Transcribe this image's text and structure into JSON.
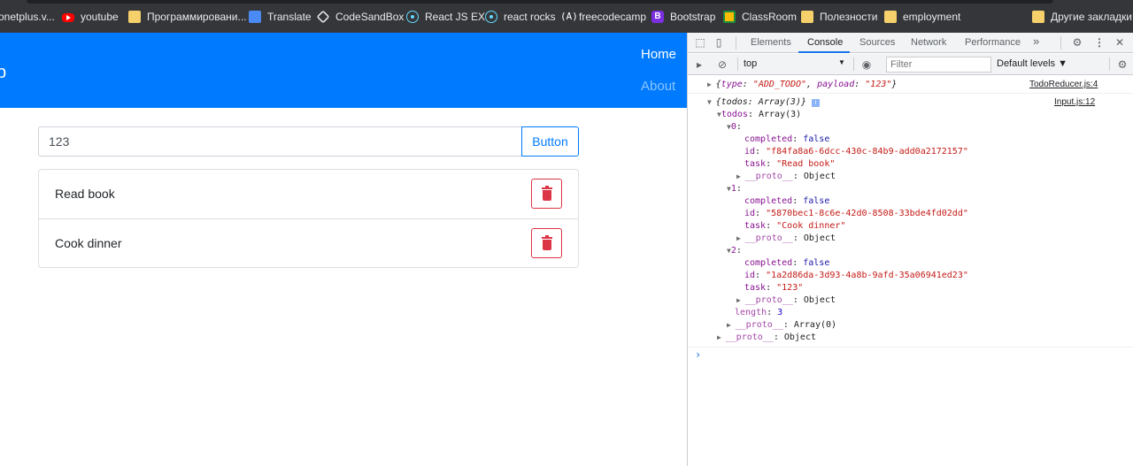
{
  "bookmarks": [
    {
      "label": "onetplus.v...",
      "icon": "none"
    },
    {
      "label": "youtube",
      "icon": "youtube-icon"
    },
    {
      "label": "Программировани...",
      "icon": "folder-icon"
    },
    {
      "label": "Translate",
      "icon": "translate-icon"
    },
    {
      "label": "CodeSandBox",
      "icon": "codesandbox-icon"
    },
    {
      "label": "React JS EX",
      "icon": "react-icon"
    },
    {
      "label": "react rocks",
      "icon": "react-icon"
    },
    {
      "label": "freecodecamp",
      "icon": "freecodecamp-icon"
    },
    {
      "label": "Bootstrap",
      "icon": "bootstrap-icon"
    },
    {
      "label": "ClassRoom",
      "icon": "classroom-icon"
    },
    {
      "label": "Полезности",
      "icon": "folder-icon"
    },
    {
      "label": "employment",
      "icon": "folder-icon"
    },
    {
      "label": "Другие закладки",
      "icon": "folder-icon"
    }
  ],
  "app": {
    "brand": "p",
    "nav": {
      "home": "Home",
      "about": "About"
    },
    "input_value": "123",
    "add_button": "Button",
    "todos": [
      {
        "task": "Read book"
      },
      {
        "task": "Cook dinner"
      }
    ],
    "colors": {
      "primary": "#007bff",
      "danger": "#dc3545"
    }
  },
  "devtools": {
    "tabs": [
      "Elements",
      "Console",
      "Sources",
      "Network",
      "Performance"
    ],
    "active_tab": "Console",
    "more_tabs": "»",
    "context": "top",
    "filter_placeholder": "Filter",
    "levels": "Default levels ▼",
    "messages": [
      {
        "summary_type_key": "type",
        "summary_type_val": "\"ADD_TODO\"",
        "summary_payload_key": "payload",
        "summary_payload_val": "\"123\"",
        "source": "TodoReducer.js:4"
      },
      {
        "summary": "{todos: Array(3)}",
        "source": "Input.js:12"
      }
    ],
    "tree": {
      "todos_label": "todos",
      "todos_val": "Array(3)",
      "items": [
        {
          "index": "0",
          "completed": "false",
          "id": "\"f84fa8a6-6dcc-430c-84b9-add0a2172157\"",
          "task": "\"Read book\""
        },
        {
          "index": "1",
          "completed": "false",
          "id": "\"5870bec1-8c6e-42d0-8508-33bde4fd02dd\"",
          "task": "\"Cook dinner\""
        },
        {
          "index": "2",
          "completed": "false",
          "id": "\"1a2d86da-3d93-4a8b-9afd-35a06941ed23\"",
          "task": "\"123\""
        }
      ],
      "proto_key": "__proto__",
      "proto_object": "Object",
      "proto_array": "Array(0)",
      "length_key": "length",
      "length_val": "3",
      "completed_key": "completed",
      "id_key": "id",
      "task_key": "task"
    }
  }
}
